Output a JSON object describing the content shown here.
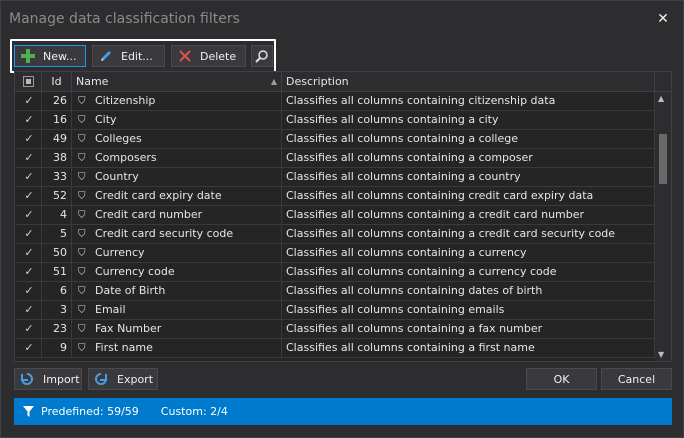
{
  "window": {
    "title": "Manage data classification filters",
    "close_label": "✕"
  },
  "toolbar": {
    "new_label": "New...",
    "edit_label": "Edit...",
    "delete_label": "Delete"
  },
  "grid": {
    "columns": {
      "id": "Id",
      "name": "Name",
      "description": "Description"
    },
    "rows": [
      {
        "id": "26",
        "name": "Citizenship",
        "description": "Classifies all columns containing citizenship data"
      },
      {
        "id": "16",
        "name": "City",
        "description": "Classifies all columns containing a city"
      },
      {
        "id": "49",
        "name": "Colleges",
        "description": "Classifies all columns containing a college"
      },
      {
        "id": "38",
        "name": "Composers",
        "description": "Classifies all columns containing a composer"
      },
      {
        "id": "33",
        "name": "Country",
        "description": "Classifies all columns containing a country"
      },
      {
        "id": "52",
        "name": "Credit card expiry date",
        "description": "Classifies all columns containing credit card expiry data"
      },
      {
        "id": "4",
        "name": "Credit card number",
        "description": "Classifies all columns containing a credit card number"
      },
      {
        "id": "5",
        "name": "Credit card security code",
        "description": "Classifies all columns containing a credit card security code"
      },
      {
        "id": "50",
        "name": "Currency",
        "description": "Classifies all columns containing a currency"
      },
      {
        "id": "51",
        "name": "Currency code",
        "description": "Classifies all columns containing a currency code"
      },
      {
        "id": "6",
        "name": "Date of Birth",
        "description": "Classifies all columns containing dates of birth"
      },
      {
        "id": "3",
        "name": "Email",
        "description": "Classifies all columns containing emails"
      },
      {
        "id": "23",
        "name": "Fax Number",
        "description": "Classifies all columns containing a fax number"
      },
      {
        "id": "9",
        "name": "First name",
        "description": "Classifies all columns containing a first name"
      }
    ]
  },
  "footer": {
    "import_label": "Import",
    "export_label": "Export",
    "ok_label": "OK",
    "cancel_label": "Cancel"
  },
  "status": {
    "predefined": "Predefined: 59/59",
    "custom": "Custom: 2/4"
  },
  "colors": {
    "accent": "#007acc",
    "new_icon": "#4caf50",
    "edit_icon": "#4a9be0",
    "delete_icon": "#e05050"
  }
}
